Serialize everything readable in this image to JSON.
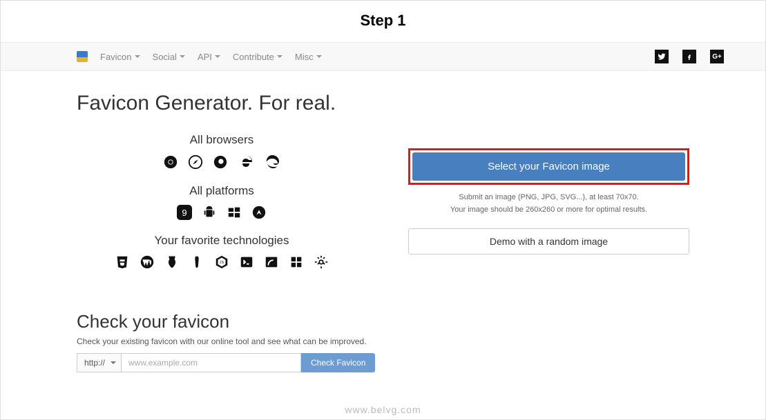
{
  "step_title": "Step 1",
  "nav": {
    "items": [
      "Favicon",
      "Social",
      "API",
      "Contribute",
      "Misc"
    ]
  },
  "hero": "Favicon Generator. For real.",
  "sections": {
    "browsers": "All browsers",
    "platforms": "All platforms",
    "technologies": "Your favorite technologies"
  },
  "actions": {
    "select_label": "Select your Favicon image",
    "hint1": "Submit an image (PNG, JPG, SVG...), at least 70x70.",
    "hint2": "Your image should be 260x260 or more for optimal results.",
    "demo_label": "Demo with a random image"
  },
  "check": {
    "heading": "Check your favicon",
    "sub": "Check your existing favicon with our online tool and see what can be improved.",
    "scheme": "http://",
    "placeholder": "www.example.com",
    "button": "Check Favicon"
  },
  "watermark": "www.belvg.com"
}
